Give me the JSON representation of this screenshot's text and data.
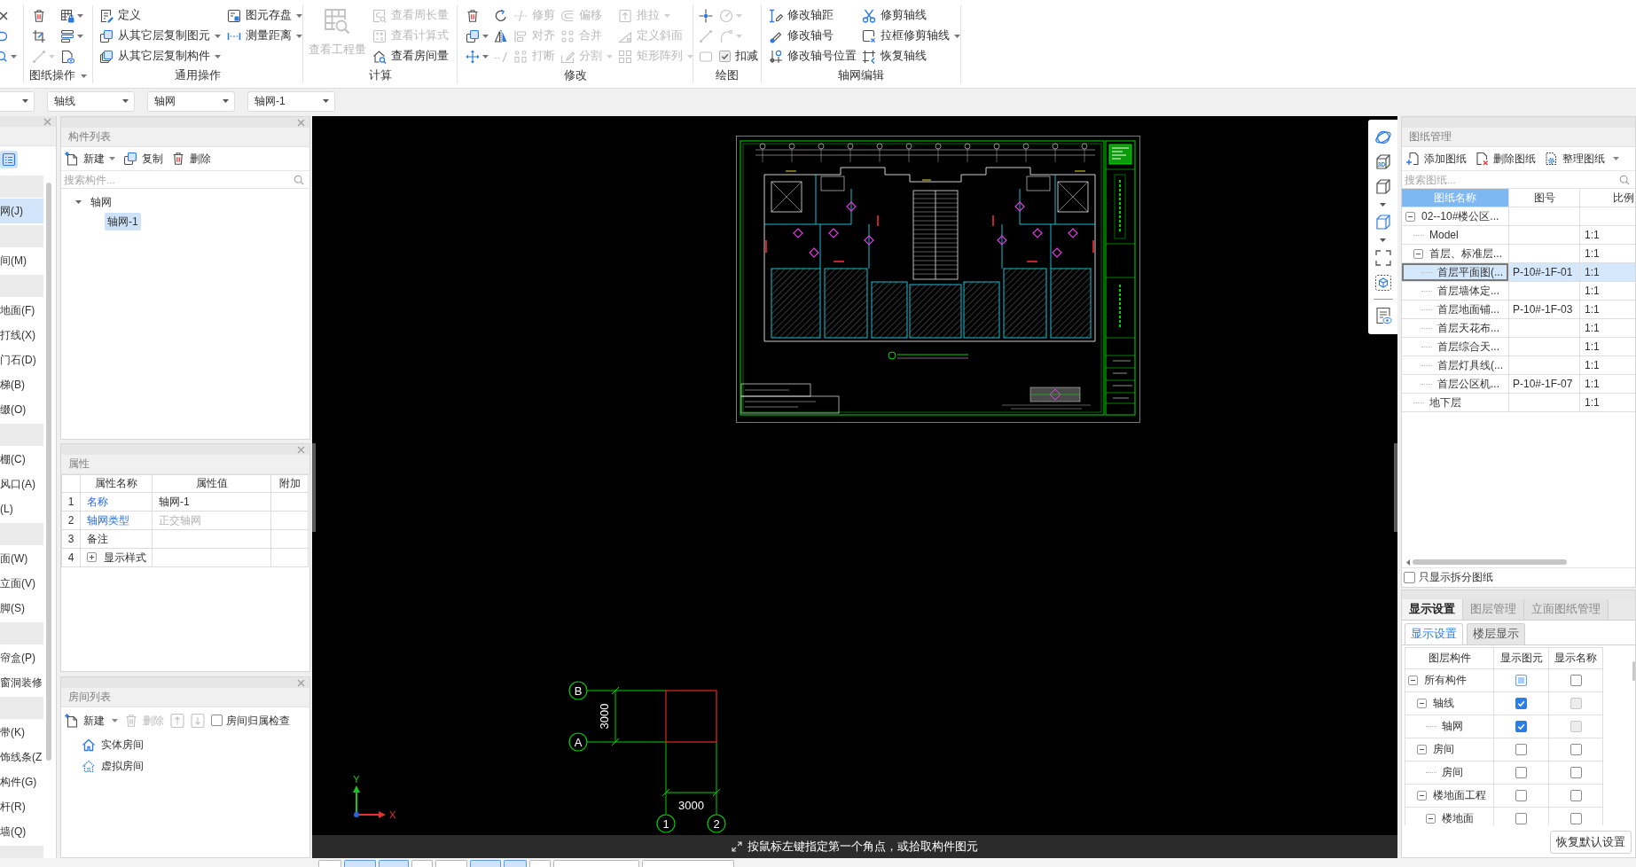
{
  "ribbon": {
    "groups": [
      {
        "label": "图纸操作",
        "dropdown": true,
        "columns": [
          [
            {
              "kind": "icon",
              "dropdown": false,
              "disabled": false
            },
            {
              "kind": "icon",
              "dropdown": false,
              "disabled": false
            },
            {
              "kind": "icon",
              "dropdown": true,
              "disabled": true
            }
          ],
          [
            {
              "kind": "icon",
              "dropdown": true,
              "disabled": false
            },
            {
              "kind": "icon",
              "dropdown": true,
              "disabled": false
            },
            {
              "kind": "icon",
              "dropdown": false,
              "disabled": false
            }
          ]
        ]
      },
      {
        "label": "通用操作",
        "dropdown": false,
        "columns": [
          [
            {
              "kind": "text",
              "label": "定义",
              "dropdown": false,
              "disabled": false
            },
            {
              "kind": "text",
              "label": "从其它层复制图元",
              "dropdown": true,
              "disabled": false
            },
            {
              "kind": "text",
              "label": "从其它层复制构件",
              "dropdown": true,
              "disabled": false
            }
          ],
          [
            {
              "kind": "text",
              "label": "图元存盘",
              "dropdown": true,
              "disabled": false
            },
            {
              "kind": "text",
              "label": "测量距离",
              "dropdown": true,
              "disabled": false
            }
          ]
        ]
      },
      {
        "label": "计算",
        "dropdown": false,
        "columns": [
          [
            {
              "kind": "large",
              "label": "查看工程量",
              "dropdown": false,
              "disabled": true
            }
          ],
          [
            {
              "kind": "text",
              "label": "查看周长量",
              "dropdown": false,
              "disabled": true
            },
            {
              "kind": "text",
              "label": "查看计算式",
              "dropdown": false,
              "disabled": true
            },
            {
              "kind": "text",
              "label": "查看房间量",
              "dropdown": false,
              "disabled": false
            }
          ]
        ]
      },
      {
        "label": "修改",
        "dropdown": false,
        "columns": [
          [
            {
              "kind": "icon",
              "dropdown": false,
              "disabled": false
            },
            {
              "kind": "icon",
              "dropdown": true,
              "disabled": false
            },
            {
              "kind": "icon",
              "dropdown": true,
              "disabled": false
            }
          ],
          [
            {
              "kind": "icon",
              "dropdown": false,
              "disabled": false
            },
            {
              "kind": "icon",
              "dropdown": false,
              "disabled": false
            },
            {
              "kind": "icon",
              "dropdown": false,
              "disabled": true
            }
          ],
          [
            {
              "kind": "text",
              "label": "修剪",
              "dropdown": false,
              "disabled": true
            },
            {
              "kind": "text",
              "label": "对齐",
              "dropdown": false,
              "disabled": true
            },
            {
              "kind": "text",
              "label": "打断",
              "dropdown": false,
              "disabled": true
            }
          ],
          [
            {
              "kind": "text",
              "label": "偏移",
              "dropdown": false,
              "disabled": true
            },
            {
              "kind": "text",
              "label": "合并",
              "dropdown": false,
              "disabled": true
            },
            {
              "kind": "text",
              "label": "分割",
              "dropdown": true,
              "disabled": true
            }
          ],
          [
            {
              "kind": "text",
              "label": "推拉",
              "dropdown": true,
              "disabled": true
            },
            {
              "kind": "text",
              "label": "定义斜面",
              "dropdown": false,
              "disabled": true
            },
            {
              "kind": "text",
              "label": "矩形阵列",
              "dropdown": true,
              "disabled": true
            }
          ]
        ]
      },
      {
        "label": "绘图",
        "dropdown": false,
        "columns": [
          [
            {
              "kind": "icon",
              "dropdown": false,
              "disabled": false
            },
            {
              "kind": "icon",
              "dropdown": false,
              "disabled": true
            },
            {
              "kind": "icon",
              "dropdown": false,
              "disabled": true
            }
          ],
          [
            {
              "kind": "icon",
              "dropdown": true,
              "disabled": true
            },
            {
              "kind": "icon",
              "dropdown": true,
              "disabled": true
            },
            {
              "kind": "checkbox",
              "label": "扣减",
              "checked": true
            }
          ]
        ]
      },
      {
        "label": "轴网编辑",
        "dropdown": false,
        "columns": [
          [
            {
              "kind": "text",
              "label": "修改轴距",
              "dropdown": false,
              "disabled": false
            },
            {
              "kind": "text",
              "label": "修改轴号",
              "dropdown": false,
              "disabled": false
            },
            {
              "kind": "text",
              "label": "修改轴号位置",
              "dropdown": false,
              "disabled": false
            }
          ],
          [
            {
              "kind": "text",
              "label": "修剪轴线",
              "dropdown": false,
              "disabled": false
            },
            {
              "kind": "text",
              "label": "拉框修剪轴线",
              "dropdown": true,
              "disabled": false
            },
            {
              "kind": "text",
              "label": "恢复轴线",
              "dropdown": false,
              "disabled": false
            }
          ]
        ]
      }
    ]
  },
  "selectors": [
    "轴线",
    "轴网",
    "轴网-1"
  ],
  "nav_view_toggle": {
    "selected": true
  },
  "nav_items": [
    {
      "kind": "category"
    },
    {
      "kind": "item",
      "label": "网(J)",
      "selected": true
    },
    {
      "kind": "category"
    },
    {
      "kind": "item",
      "label": "间(M)",
      "selected": false
    },
    {
      "kind": "category"
    },
    {
      "kind": "item",
      "label": "地面(F)",
      "selected": false
    },
    {
      "kind": "item",
      "label": "打线(X)",
      "selected": false
    },
    {
      "kind": "item",
      "label": "门石(D)",
      "selected": false
    },
    {
      "kind": "item",
      "label": "梯(B)",
      "selected": false
    },
    {
      "kind": "item",
      "label": "缀(O)",
      "selected": false
    },
    {
      "kind": "category"
    },
    {
      "kind": "item",
      "label": "棚(C)",
      "selected": false
    },
    {
      "kind": "item",
      "label": "风口(A)",
      "selected": false
    },
    {
      "kind": "item",
      "label": "(L)",
      "selected": false
    },
    {
      "kind": "category"
    },
    {
      "kind": "item",
      "label": "面(W)",
      "selected": false
    },
    {
      "kind": "item",
      "label": "立面(V)",
      "selected": false
    },
    {
      "kind": "item",
      "label": "脚(S)",
      "selected": false
    },
    {
      "kind": "category"
    },
    {
      "kind": "item",
      "label": "帘盒(P)",
      "selected": false
    },
    {
      "kind": "item",
      "label": "窗洞装修",
      "selected": false
    },
    {
      "kind": "category"
    },
    {
      "kind": "item",
      "label": "带(K)",
      "selected": false
    },
    {
      "kind": "item",
      "label": "饰线条(Z",
      "selected": false
    },
    {
      "kind": "item",
      "label": "构件(G)",
      "selected": false
    },
    {
      "kind": "item",
      "label": "杆(R)",
      "selected": false
    },
    {
      "kind": "item",
      "label": "墙(Q)",
      "selected": false
    },
    {
      "kind": "category"
    }
  ],
  "component_list": {
    "title": "构件列表",
    "toolbar": [
      {
        "label": "新建",
        "dropdown": true
      },
      {
        "label": "复制",
        "dropdown": false
      },
      {
        "label": "删除",
        "dropdown": false
      }
    ],
    "search_placeholder": "搜索构件...",
    "tree": [
      {
        "label": "轴网",
        "expanded": true,
        "selected": false,
        "children": [
          {
            "label": "轴网-1",
            "selected": true
          }
        ]
      }
    ]
  },
  "properties": {
    "title": "属性",
    "columns": [
      "属性名称",
      "属性值",
      "附加"
    ],
    "rows": [
      {
        "index": "1",
        "name": "名称",
        "value": "轴网-1",
        "link": true,
        "value_muted": false,
        "expandable": false
      },
      {
        "index": "2",
        "name": "轴网类型",
        "value": "正交轴网",
        "link": true,
        "value_muted": true,
        "expandable": false
      },
      {
        "index": "3",
        "name": "备注",
        "link": false,
        "expandable": false
      },
      {
        "index": "4",
        "name": "显示样式",
        "link": false,
        "expandable": true,
        "expanded": false
      }
    ]
  },
  "room_list": {
    "title": "房间列表",
    "toolbar": [
      {
        "kind": "new",
        "label": "新建",
        "dropdown": true,
        "disabled": false
      },
      {
        "kind": "delete",
        "label": "删除",
        "dropdown": false,
        "disabled": true
      },
      {
        "kind": "up",
        "disabled": true
      },
      {
        "kind": "down",
        "disabled": true
      },
      {
        "kind": "checkbox",
        "label": "房间归属检查",
        "checked": false
      }
    ],
    "items": [
      {
        "kind": "solid",
        "label": "实体房间"
      },
      {
        "kind": "virtual",
        "label": "虚拟房间"
      }
    ]
  },
  "canvas": {
    "row_axes": [
      "B",
      "A"
    ],
    "column_axes": [
      "1",
      "2"
    ],
    "row_spacing": "3000",
    "column_spacing": "3000",
    "axis_y": "Y",
    "axis_x": "X",
    "view_3d_label": "3D",
    "status_message": "按鼠标左键指定第一个角点，或拾取构件图元"
  },
  "drawing_manager": {
    "title": "图纸管理",
    "toolbar": [
      {
        "label": "添加图纸",
        "dropdown": false
      },
      {
        "label": "删除图纸",
        "dropdown": false
      },
      {
        "label": "整理图纸",
        "dropdown": true
      }
    ],
    "search_placeholder": "搜索图纸...",
    "columns": [
      {
        "label": "图纸名称",
        "selected": true
      },
      {
        "label": "图号",
        "selected": false
      },
      {
        "label": "比例",
        "selected": false
      }
    ],
    "rows": [
      {
        "name": "02--10#楼公区...",
        "selected": false,
        "expanded": true,
        "children": [
          {
            "name": "Model",
            "scale": "1:1",
            "selected": false
          },
          {
            "name": "首层、标准层...",
            "scale": "1:1",
            "selected": false,
            "expanded": true,
            "children": [
              {
                "name": "首层平面图(...",
                "number": "P-10#-1F-01",
                "scale": "1:1",
                "selected": true
              },
              {
                "name": "首层墙体定...",
                "scale": "1:1",
                "selected": false
              },
              {
                "name": "首层地面铺...",
                "number": "P-10#-1F-03",
                "scale": "1:1",
                "selected": false
              },
              {
                "name": "首层天花布...",
                "scale": "1:1",
                "selected": false
              },
              {
                "name": "首层综合天...",
                "scale": "1:1",
                "selected": false
              },
              {
                "name": "首层灯具线(...",
                "scale": "1:1",
                "selected": false
              },
              {
                "name": "首层公区机...",
                "number": "P-10#-1F-07",
                "scale": "1:1",
                "selected": false
              }
            ]
          },
          {
            "name": "地下层",
            "scale": "1:1",
            "selected": false
          }
        ]
      }
    ],
    "split_only": {
      "label": "只显示拆分图纸",
      "checked": false
    }
  },
  "display_settings": {
    "tabs": [
      {
        "label": "显示设置",
        "selected": true
      },
      {
        "label": "图层管理",
        "selected": false
      },
      {
        "label": "立面图纸管理",
        "selected": false
      }
    ],
    "subtabs": [
      {
        "label": "显示设置",
        "selected": true
      },
      {
        "label": "楼层显示",
        "selected": false
      }
    ],
    "columns": [
      "图层构件",
      "显示图元",
      "显示名称"
    ],
    "rows": [
      {
        "name": "所有构件",
        "expanded": true,
        "show_element": {
          "checked": false,
          "mixed": true,
          "disabled": false
        },
        "show_name": {
          "checked": false,
          "disabled": false
        },
        "children": [
          {
            "name": "轴线",
            "expanded": true,
            "show_element": {
              "checked": true,
              "disabled": false
            },
            "show_name": {
              "checked": false,
              "disabled": true
            },
            "children": [
              {
                "name": "轴网",
                "show_element": {
                  "checked": true,
                  "disabled": false
                },
                "show_name": {
                  "checked": false,
                  "disabled": true
                }
              }
            ]
          },
          {
            "name": "房间",
            "expanded": true,
            "show_element": {
              "checked": false,
              "disabled": false
            },
            "show_name": {
              "checked": false,
              "disabled": false
            },
            "children": [
              {
                "name": "房间",
                "show_element": {
                  "checked": false,
                  "disabled": false
                },
                "show_name": {
                  "checked": false,
                  "disabled": false
                }
              }
            ]
          },
          {
            "name": "楼地面工程",
            "expanded": true,
            "show_element": {
              "checked": false,
              "disabled": false
            },
            "show_name": {
              "checked": false,
              "disabled": false
            },
            "children": [
              {
                "name": "楼地面",
                "expanded": true,
                "show_element": {
                  "checked": false,
                  "disabled": false
                },
                "show_name": {
                  "checked": false,
                  "disabled": false
                }
              }
            ]
          }
        ]
      }
    ],
    "reset_button": "恢复默认设置"
  },
  "status_buttons": [
    {
      "selected": false
    },
    {
      "selected": true
    },
    {
      "selected": true
    },
    {
      "selected": false
    },
    {
      "selected": false
    },
    {
      "selected": true
    },
    {
      "selected": true
    },
    {
      "selected": false
    },
    {
      "selected": false
    },
    {
      "selected": false
    }
  ]
}
